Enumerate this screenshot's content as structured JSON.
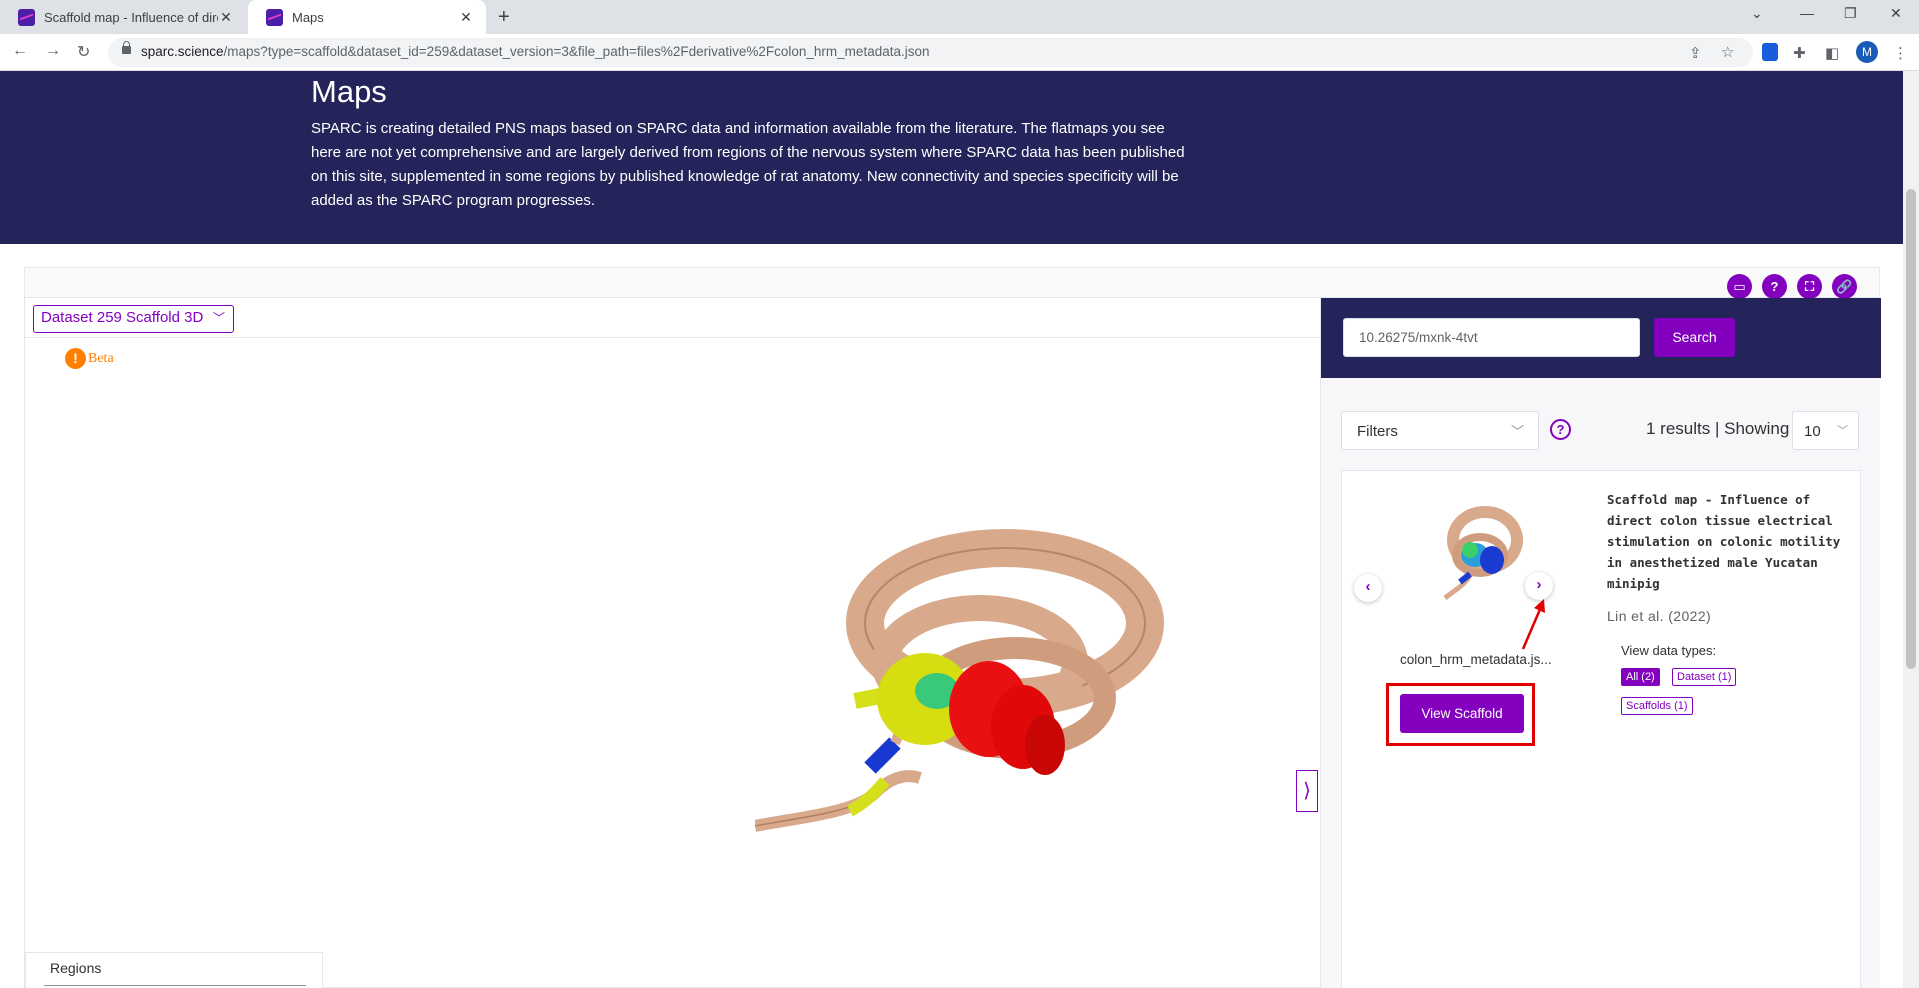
{
  "browser": {
    "tabs": [
      {
        "title": "Scaffold map - Influence of direct colon tissue electrical stimulation",
        "active": false
      },
      {
        "title": "Maps",
        "active": true
      }
    ],
    "url_host": "sparc.science",
    "url_path": "/maps?type=scaffold&dataset_id=259&dataset_version=3&file_path=files%2Fderivative%2Fcolon_hrm_metadata.json",
    "profile_initial": "M"
  },
  "hero": {
    "title": "Maps",
    "description": "SPARC is creating detailed PNS maps based on SPARC data and information available from the literature. The flatmaps you see here are not yet comprehensive and are largely derived from regions of the nervous system where SPARC data has been published on this site, supplemented in some regions by published knowledge of rat anatomy. New connectivity and species specificity will be added as the SPARC program progresses."
  },
  "viewer": {
    "dataset_select": "Dataset 259 Scaffold 3D",
    "beta_label": "Beta",
    "regions_label": "Regions",
    "drawer_toggle": "⟩"
  },
  "sidebar": {
    "search_value": "10.26275/mxnk-4tvt",
    "search_button": "Search",
    "filters_label": "Filters",
    "results_text": "1 results | Showing",
    "per_page": "10",
    "card": {
      "title": "Scaffold map - Influence of direct colon tissue electrical stimulation on colonic motility in anesthetized male Yucatan minipig",
      "authors": "Lin et al. (2022)",
      "file_name": "colon_hrm_metadata.js...",
      "view_button": "View Scaffold",
      "data_types_label": "View data types:",
      "tags": [
        "All (2)",
        "Dataset (1)",
        "Scaffolds (1)"
      ]
    }
  },
  "colors": {
    "brand_purple": "#8300bf",
    "hero_navy": "#24245b",
    "highlight_red": "#e00000"
  }
}
